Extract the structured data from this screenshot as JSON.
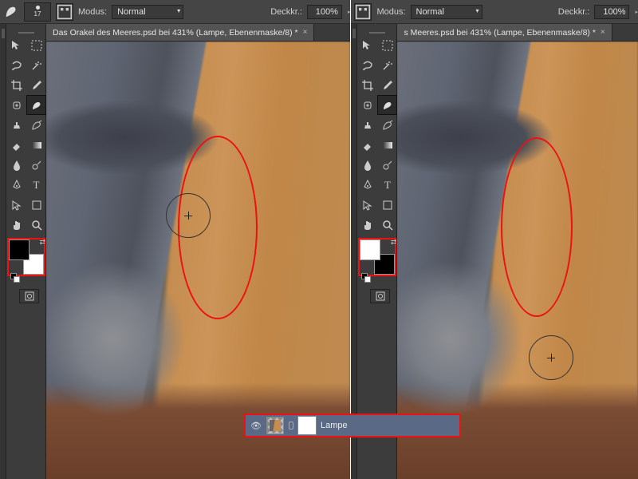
{
  "optbar": {
    "brush_size": "17",
    "modus_label": "Modus:",
    "modus_value": "Normal",
    "deckkr_label": "Deckkr.:",
    "deckkr_value": "100%"
  },
  "tab_title_full": "Das Orakel des Meeres.psd bei 431% (Lampe, Ebenenmaske/8) *",
  "tab_title_trunc": "s Meeres.psd bei 431% (Lampe, Ebenenmaske/8) *",
  "swatches": {
    "left": {
      "fg": "#000000",
      "bg": "#ffffff"
    },
    "right": {
      "fg": "#ffffff",
      "bg": "#000000"
    }
  },
  "layer": {
    "name": "Lampe",
    "visible": true
  },
  "tool_names": [
    "move-tool",
    "marquee-tool",
    "lasso-tool",
    "magic-wand-tool",
    "crop-tool",
    "eyedropper-tool",
    "healing-brush-tool",
    "brush-tool",
    "clone-stamp-tool",
    "history-brush-tool",
    "eraser-tool",
    "gradient-tool",
    "blur-tool",
    "dodge-tool",
    "pen-tool",
    "type-tool",
    "path-select-tool",
    "shape-tool",
    "hand-tool",
    "zoom-tool"
  ]
}
